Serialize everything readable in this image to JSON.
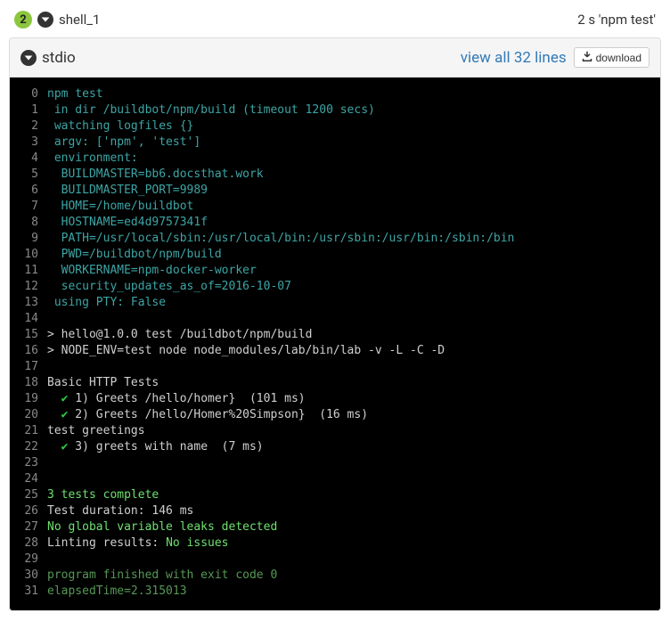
{
  "header": {
    "step_number": "2",
    "step_name": "shell_1",
    "timing": "2 s 'npm test'"
  },
  "panel": {
    "stdio_label": "stdio",
    "view_all_link": "view all 32 lines",
    "download_label": "download"
  },
  "lines": [
    {
      "n": 0,
      "segs": [
        {
          "c": "cyan",
          "t": "npm test"
        }
      ]
    },
    {
      "n": 1,
      "segs": [
        {
          "c": "cyan",
          "t": " in dir /buildbot/npm/build (timeout 1200 secs)"
        }
      ]
    },
    {
      "n": 2,
      "segs": [
        {
          "c": "cyan",
          "t": " watching logfiles {}"
        }
      ]
    },
    {
      "n": 3,
      "segs": [
        {
          "c": "cyan",
          "t": " argv: ['npm', 'test']"
        }
      ]
    },
    {
      "n": 4,
      "segs": [
        {
          "c": "cyan",
          "t": " environment:"
        }
      ]
    },
    {
      "n": 5,
      "segs": [
        {
          "c": "cyan",
          "t": "  BUILDMASTER=bb6.docsthat.work"
        }
      ]
    },
    {
      "n": 6,
      "segs": [
        {
          "c": "cyan",
          "t": "  BUILDMASTER_PORT=9989"
        }
      ]
    },
    {
      "n": 7,
      "segs": [
        {
          "c": "cyan",
          "t": "  HOME=/home/buildbot"
        }
      ]
    },
    {
      "n": 8,
      "segs": [
        {
          "c": "cyan",
          "t": "  HOSTNAME=ed4d9757341f"
        }
      ]
    },
    {
      "n": 9,
      "segs": [
        {
          "c": "cyan",
          "t": "  PATH=/usr/local/sbin:/usr/local/bin:/usr/sbin:/usr/bin:/sbin:/bin"
        }
      ]
    },
    {
      "n": 10,
      "segs": [
        {
          "c": "cyan",
          "t": "  PWD=/buildbot/npm/build"
        }
      ]
    },
    {
      "n": 11,
      "segs": [
        {
          "c": "cyan",
          "t": "  WORKERNAME=npm-docker-worker"
        }
      ]
    },
    {
      "n": 12,
      "segs": [
        {
          "c": "cyan",
          "t": "  security_updates_as_of=2016-10-07"
        }
      ]
    },
    {
      "n": 13,
      "segs": [
        {
          "c": "cyan",
          "t": " using PTY: False"
        }
      ]
    },
    {
      "n": 14,
      "segs": []
    },
    {
      "n": 15,
      "segs": [
        {
          "c": "default",
          "t": "> hello@1.0.0 test /buildbot/npm/build"
        }
      ]
    },
    {
      "n": 16,
      "segs": [
        {
          "c": "default",
          "t": "> NODE_ENV=test node node_modules/lab/bin/lab -v -L -C -D"
        }
      ]
    },
    {
      "n": 17,
      "segs": []
    },
    {
      "n": 18,
      "segs": [
        {
          "c": "default",
          "t": "Basic HTTP Tests"
        }
      ]
    },
    {
      "n": 19,
      "segs": [
        {
          "c": "default",
          "t": "  "
        },
        {
          "c": "check",
          "t": "✔"
        },
        {
          "c": "default",
          "t": " 1) Greets /hello/homer}  (101 ms)"
        }
      ]
    },
    {
      "n": 20,
      "segs": [
        {
          "c": "default",
          "t": "  "
        },
        {
          "c": "check",
          "t": "✔"
        },
        {
          "c": "default",
          "t": " 2) Greets /hello/Homer%20Simpson}  (16 ms)"
        }
      ]
    },
    {
      "n": 21,
      "segs": [
        {
          "c": "default",
          "t": "test greetings"
        }
      ]
    },
    {
      "n": 22,
      "segs": [
        {
          "c": "default",
          "t": "  "
        },
        {
          "c": "check",
          "t": "✔"
        },
        {
          "c": "default",
          "t": " 3) greets with name  (7 ms)"
        }
      ]
    },
    {
      "n": 23,
      "segs": []
    },
    {
      "n": 24,
      "segs": []
    },
    {
      "n": 25,
      "segs": [
        {
          "c": "green-bright",
          "t": "3 tests complete"
        }
      ]
    },
    {
      "n": 26,
      "segs": [
        {
          "c": "default",
          "t": "Test duration: 146 ms"
        }
      ]
    },
    {
      "n": 27,
      "segs": [
        {
          "c": "green-bright",
          "t": "No global variable leaks detected"
        }
      ]
    },
    {
      "n": 28,
      "segs": [
        {
          "c": "default",
          "t": "Linting results: "
        },
        {
          "c": "green-bright",
          "t": "No issues"
        }
      ]
    },
    {
      "n": 29,
      "segs": []
    },
    {
      "n": 30,
      "segs": [
        {
          "c": "green-dim",
          "t": "program finished with exit code 0"
        }
      ]
    },
    {
      "n": 31,
      "segs": [
        {
          "c": "green-dim",
          "t": "elapsedTime=2.315013"
        }
      ]
    }
  ]
}
